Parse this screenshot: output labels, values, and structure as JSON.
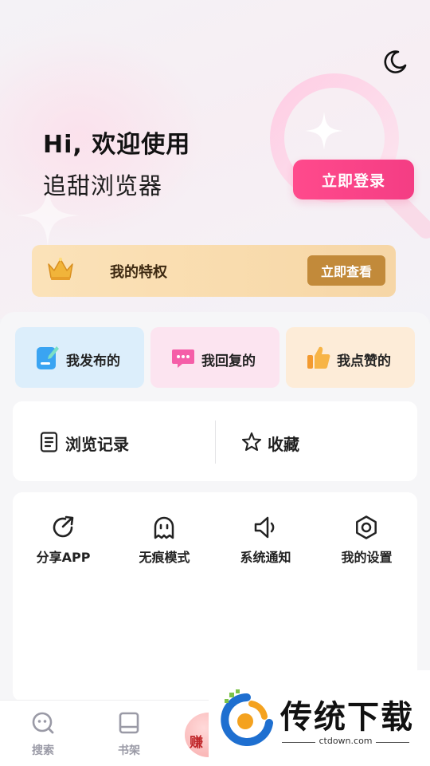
{
  "header": {
    "greeting_line1": "Hi, 欢迎使用",
    "greeting_line2": "追甜浏览器",
    "login_button": "立即登录",
    "theme_toggle_icon": "moon-icon"
  },
  "privilege": {
    "title": "我的特权",
    "button": "立即查看",
    "icon": "crown-icon"
  },
  "quick_actions": [
    {
      "label": "我发布的",
      "icon": "edit-document-icon",
      "color": "#dceefb"
    },
    {
      "label": "我回复的",
      "icon": "chat-bubble-icon",
      "color": "#fce4f0"
    },
    {
      "label": "我点赞的",
      "icon": "thumbs-up-icon",
      "color": "#fdecd8"
    }
  ],
  "history": {
    "browse_label": "浏览记录",
    "favorites_label": "收藏"
  },
  "tools": [
    {
      "label": "分享APP",
      "icon": "share-icon"
    },
    {
      "label": "无痕模式",
      "icon": "ghost-icon"
    },
    {
      "label": "系统通知",
      "icon": "speaker-icon"
    },
    {
      "label": "我的设置",
      "icon": "settings-icon"
    }
  ],
  "tabbar": {
    "items": [
      {
        "label": "搜索",
        "icon": "search-tab-icon"
      },
      {
        "label": "书架",
        "icon": "bookshelf-icon"
      },
      {
        "label": "赚",
        "icon": "earn-icon"
      }
    ]
  },
  "watermark": {
    "text": "传统下载",
    "sub": "ctdown.com"
  },
  "colors": {
    "accent_pink": "#f43d84",
    "privilege_gold": "#c28a3a"
  }
}
